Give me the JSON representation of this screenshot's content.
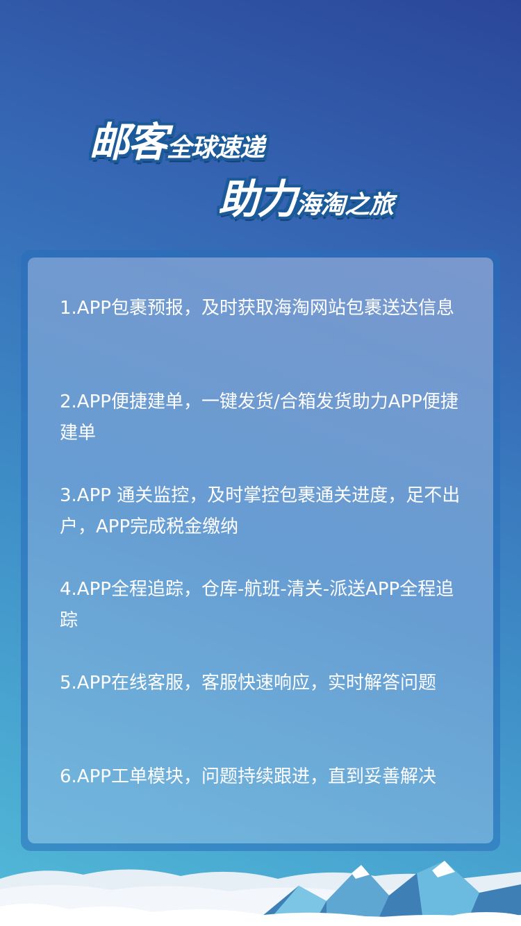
{
  "title": {
    "line1_big": "邮客",
    "line1_small": "全球速递",
    "line2_big": "助力",
    "line2_small": "海淘之旅"
  },
  "features": [
    {
      "text": "1.APP包裹预报，及时获取海淘网站包裹送达信息"
    },
    {
      "text": "2.APP便捷建单，一键发货/合箱发货助力APP便捷建单"
    },
    {
      "text": "3.APP 通关监控，及时掌控包裹通关进度，足不出户，APP完成税金缴纳"
    },
    {
      "text": "4.APP全程追踪，仓库-航班-清关-派送APP全程追踪"
    },
    {
      "text": "5.APP在线客服，客服快速响应，实时解答问题"
    },
    {
      "text": "6.APP工单模块，问题持续跟进，直到妥善解决"
    }
  ],
  "colors": {
    "background_top": "#2b4698",
    "background_bottom": "#52bbd8",
    "title_stroke": "#1d5a9a",
    "text": "#ffffff"
  }
}
